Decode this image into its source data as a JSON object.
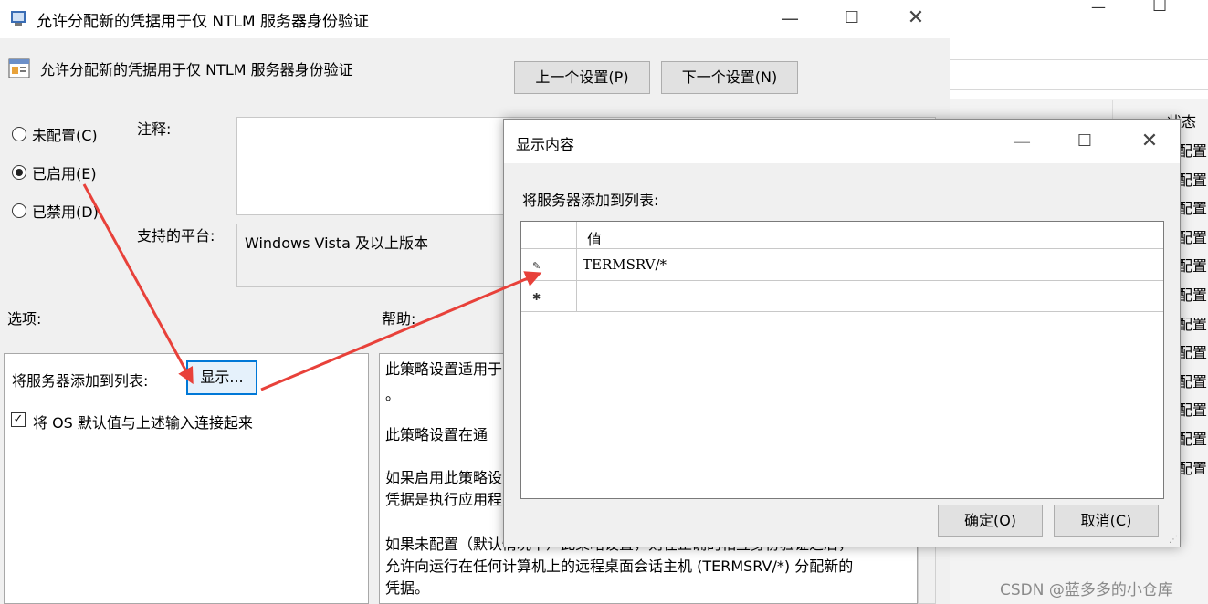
{
  "main_window": {
    "title": "允许分配新的凭据用于仅 NTLM 服务器身份验证",
    "policy_name": "允许分配新的凭据用于仅 NTLM 服务器身份验证",
    "prev_button": "上一个设置(P)",
    "next_button": "下一个设置(N)",
    "radio_not_configured": "未配置(C)",
    "radio_enabled": "已启用(E)",
    "radio_disabled": "已禁用(D)",
    "selected_radio": "已启用(E)",
    "comment_label": "注释:",
    "platform_label": "支持的平台:",
    "platform_value": "Windows Vista 及以上版本",
    "options_label": "选项:",
    "help_label": "帮助:",
    "options": {
      "add_servers_label": "将服务器添加到列表:",
      "show_button": "显示...",
      "checkbox_label": "将 OS 默认值与上述输入连接起来",
      "checkbox_checked": true
    },
    "help_paragraphs": [
      "此策略设置适用于",
      "。",
      "此策略设置在通",
      "如果启用此策略设",
      "凭据是执行应用程",
      "如果未配置（默认情况下）此策略设置，则在正确的相互身份验证之后，",
      "允许向运行在任何计算机上的远程桌面会话主机 (TERMSRV/*) 分配新的",
      "凭据。"
    ]
  },
  "show_dialog": {
    "title": "显示内容",
    "list_label": "将服务器添加到列表:",
    "column_header": "值",
    "rows": [
      "TERMSRV/*",
      ""
    ],
    "ok_button": "确定(O)",
    "cancel_button": "取消(C)"
  },
  "background_window": {
    "status_header": "状态",
    "status_cells": [
      "配置",
      "配置",
      "配置",
      "配置",
      "配置",
      "配置",
      "配置",
      "配置",
      "配置",
      "配置",
      "配置",
      "配置"
    ]
  },
  "watermark": "CSDN @蓝多多的小仓库",
  "colors": {
    "accent": "#0078d7",
    "arrow": "#e8413a",
    "window_bg": "#f0f0f0"
  }
}
